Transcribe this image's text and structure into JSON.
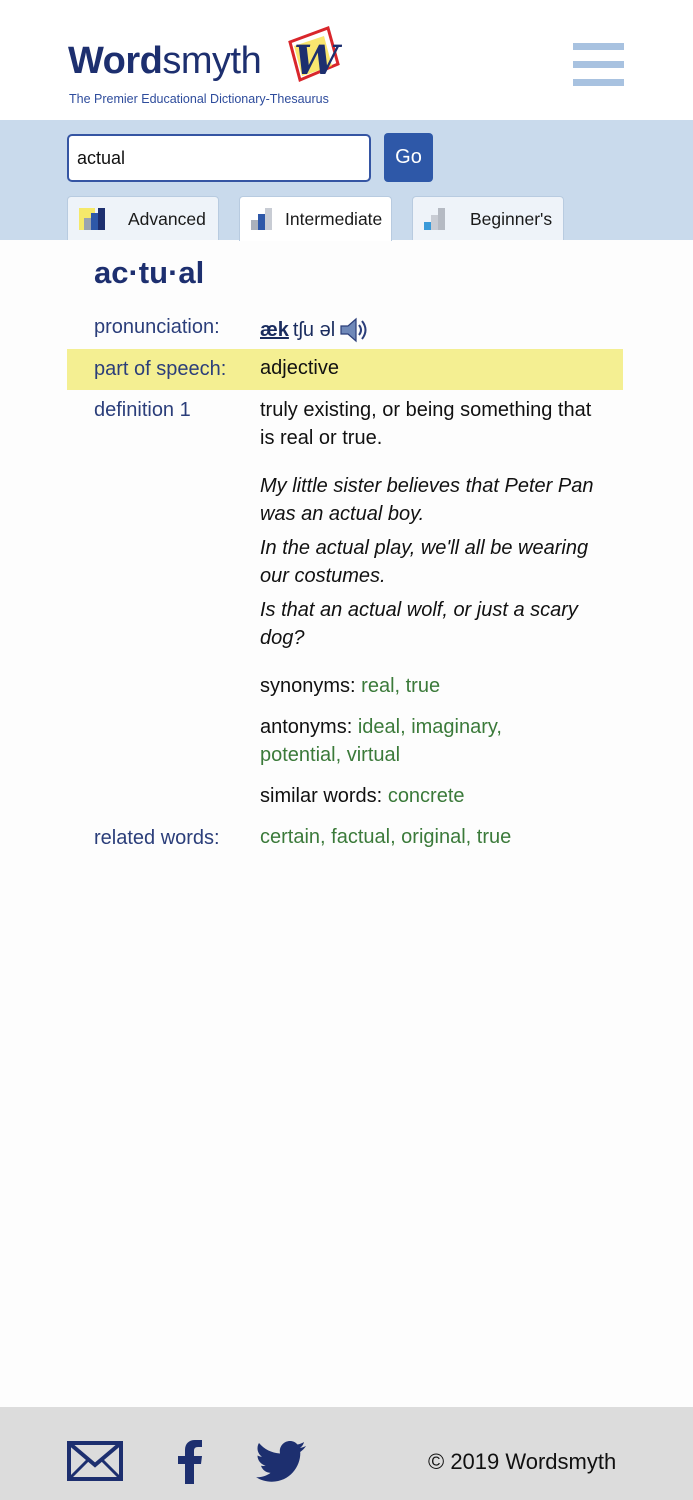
{
  "header": {
    "logo_bold": "Word",
    "logo_light": "smyth",
    "tagline": "The Premier Educational Dictionary-Thesaurus"
  },
  "search": {
    "value": "actual",
    "go_label": "Go"
  },
  "tabs": [
    {
      "label": "Advanced",
      "active": false
    },
    {
      "label": "Intermediate",
      "active": true
    },
    {
      "label": "Beginner's",
      "active": false
    }
  ],
  "entry": {
    "headword": "ac·tu·al",
    "pronunciation_label": "pronunciation:",
    "pronunciation_stress": "æk",
    "pronunciation_rest": "tʃu əl",
    "pos_label": "part of speech:",
    "pos_value": "adjective",
    "definition_label": "definition 1",
    "definition_text": "truly existing, or being something that is real or true.",
    "examples": [
      "My little sister believes that Peter Pan was an actual boy.",
      "In the actual play, we'll all be wearing our costumes.",
      "Is that an actual wolf, or just a scary dog?"
    ],
    "synonyms_label": "synonyms:",
    "synonyms": "real, true",
    "antonyms_label": "antonyms:",
    "antonyms": "ideal, imaginary, potential, virtual",
    "similar_label": "similar words:",
    "similar": "concrete",
    "related_label": "related words:",
    "related": "certain, factual, original, true"
  },
  "footer": {
    "copyright": "© 2019 Wordsmyth",
    "icons": [
      "mail-icon",
      "facebook-icon",
      "twitter-icon"
    ]
  },
  "colors": {
    "brand_navy": "#1d2f6f",
    "search_band": "#c9daec",
    "go_button": "#2e58a8",
    "highlight": "#f4ef92",
    "link_green": "#3b7a3a",
    "footer_bg": "#dcdcdc"
  }
}
